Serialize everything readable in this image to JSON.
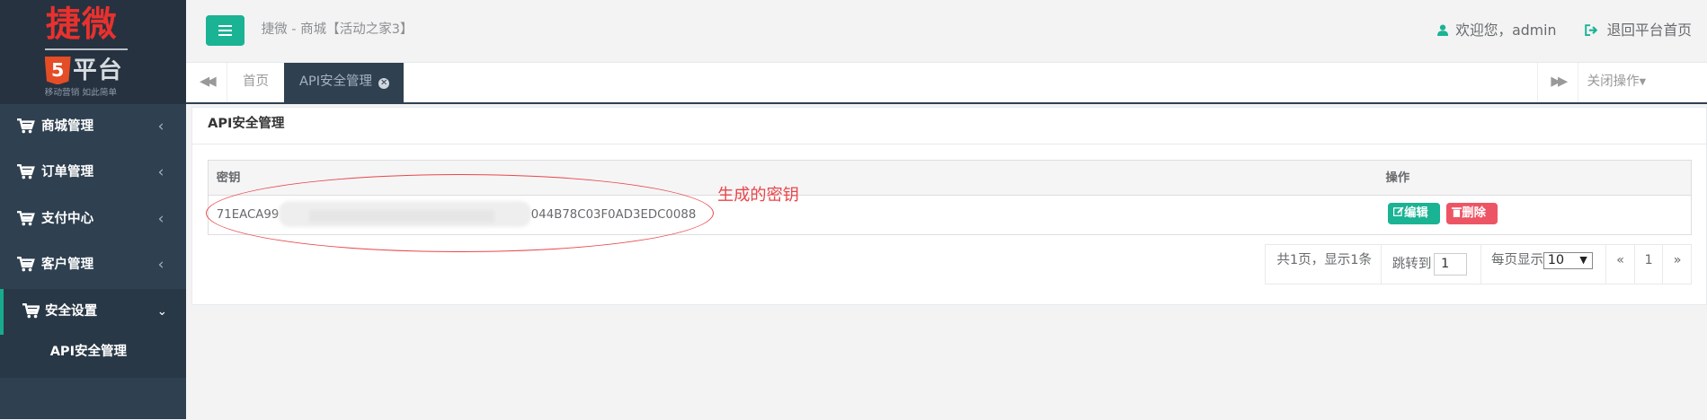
{
  "logo": {
    "big_text": "捷微",
    "badge": "5",
    "sub_text": "平台",
    "slogan": "移动营销 如此简单"
  },
  "sidebar": {
    "items": [
      {
        "label": "商城管理",
        "chevron": "‹"
      },
      {
        "label": "订单管理",
        "chevron": "‹"
      },
      {
        "label": "支付中心",
        "chevron": "‹"
      },
      {
        "label": "客户管理",
        "chevron": "‹"
      },
      {
        "label": "安全设置",
        "chevron": "⌄"
      }
    ],
    "sub_items": [
      {
        "label": "API安全管理"
      }
    ]
  },
  "header": {
    "breadcrumb": "捷微 - 商城【活动之家3】",
    "welcome": "欢迎您，admin",
    "back_label": "退回平台首页"
  },
  "tabs": {
    "left_arrow": "◀◀",
    "home": "首页",
    "active": "API安全管理",
    "close_glyph": "✕",
    "right_arrow": "▶▶",
    "close_ops": "关闭操作"
  },
  "panel": {
    "title": "API安全管理",
    "table": {
      "columns": [
        "密钥",
        "操作"
      ],
      "rows": [
        {
          "key_prefix": "71EACA99",
          "key_suffix": "044B78C03F0AD3EDC0088",
          "edit_label": "编辑",
          "delete_label": "删除"
        }
      ]
    },
    "annotation": "生成的密钥",
    "pager": {
      "summary": "共1页，显示1条",
      "jump_label": "跳转到",
      "jump_value": "1",
      "page_size_label": "每页显示",
      "page_size_value": "10",
      "prev": "«",
      "current": "1",
      "next": "»"
    }
  },
  "colors": {
    "sidebar_bg": "#2f4050",
    "accent": "#1ab394",
    "danger": "#ed5565",
    "annotation": "#e8474b",
    "logo_red": "#e8312e"
  }
}
